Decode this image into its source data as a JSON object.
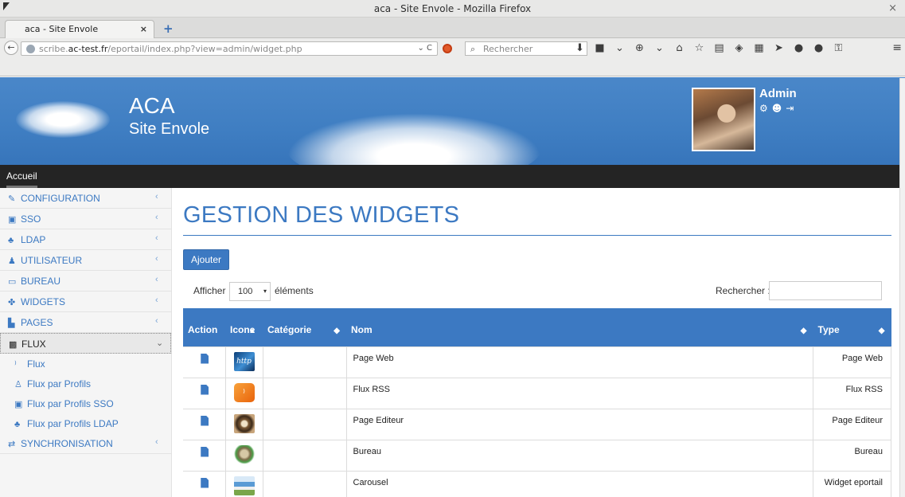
{
  "window": {
    "title": "aca - Site Envole - Mozilla Firefox",
    "close": "×"
  },
  "tab": {
    "label": "aca - Site Envole",
    "close": "×",
    "new_tab": "+"
  },
  "nav": {
    "url_prefix": "scribe.",
    "url_host": "ac-test.fr",
    "url_path": "/eportail/index.php?view=admin/widget.php",
    "url_tools": "⌄ C",
    "search_placeholder": "Rechercher",
    "back": "←",
    "menu": "≡",
    "toolbar_icons": [
      "⬇",
      "■",
      "⌄",
      "⊕",
      "⌄",
      "⌂",
      "☆",
      "▤",
      "◈",
      "▦",
      "➤",
      "●",
      "●",
      "⚿"
    ]
  },
  "header": {
    "site_name": "ACA",
    "site_subtitle": "Site Envole",
    "user_name": "Admin",
    "user_icons": [
      "⚙",
      "☻",
      "⇥"
    ]
  },
  "topnav": {
    "home": "Accueil"
  },
  "sidebar": {
    "items": [
      {
        "icon": "✎",
        "label": "CONFIGURATION",
        "chev": "‹"
      },
      {
        "icon": "▣",
        "label": "SSO",
        "chev": "‹"
      },
      {
        "icon": "♣",
        "label": "LDAP",
        "chev": "‹"
      },
      {
        "icon": "♟",
        "label": "UTILISATEUR",
        "chev": "‹"
      },
      {
        "icon": "▭",
        "label": "BUREAU",
        "chev": "‹"
      },
      {
        "icon": "✤",
        "label": "WIDGETS",
        "chev": "‹"
      },
      {
        "icon": "▙",
        "label": "PAGES",
        "chev": "‹"
      },
      {
        "icon": "▩",
        "label": "FLUX",
        "chev": "⌄"
      }
    ],
    "sub_items": [
      {
        "icon": "⁾",
        "label": "Flux"
      },
      {
        "icon": "♙",
        "label": "Flux par Profils"
      },
      {
        "icon": "▣",
        "label": "Flux par Profils SSO"
      },
      {
        "icon": "♣",
        "label": "Flux par Profils LDAP"
      }
    ],
    "last_item": {
      "icon": "⇄",
      "label": "SYNCHRONISATION",
      "chev": "‹"
    }
  },
  "main": {
    "title": "GESTION DES WIDGETS",
    "add_button": "Ajouter",
    "show_label": "Afficher",
    "show_value": "100",
    "show_arrow": "▾",
    "entries_label": "éléments",
    "search_label": "Rechercher :",
    "columns": [
      "Action",
      "Icone",
      "Catégorie",
      "Nom",
      "Type"
    ],
    "sort_icons": {
      "icone": "▲",
      "categorie": "◆",
      "nom": "◆",
      "type": "◆"
    },
    "rows": [
      {
        "icon": "web",
        "glyph": "http",
        "category": "",
        "name": "Page Web",
        "type": "Page Web"
      },
      {
        "icon": "rss",
        "glyph": "⁾",
        "category": "",
        "name": "Flux RSS",
        "type": "Flux RSS"
      },
      {
        "icon": "edit",
        "glyph": "",
        "category": "",
        "name": "Page Editeur",
        "type": "Page Editeur"
      },
      {
        "icon": "desk",
        "glyph": "",
        "category": "",
        "name": "Bureau",
        "type": "Bureau"
      },
      {
        "icon": "car",
        "glyph": "",
        "category": "",
        "name": "Carousel",
        "type": "Widget eportail"
      }
    ]
  },
  "colors": {
    "brand": "#3c79c2",
    "topnav": "#242424",
    "sidebar": "#f5f5f5"
  }
}
